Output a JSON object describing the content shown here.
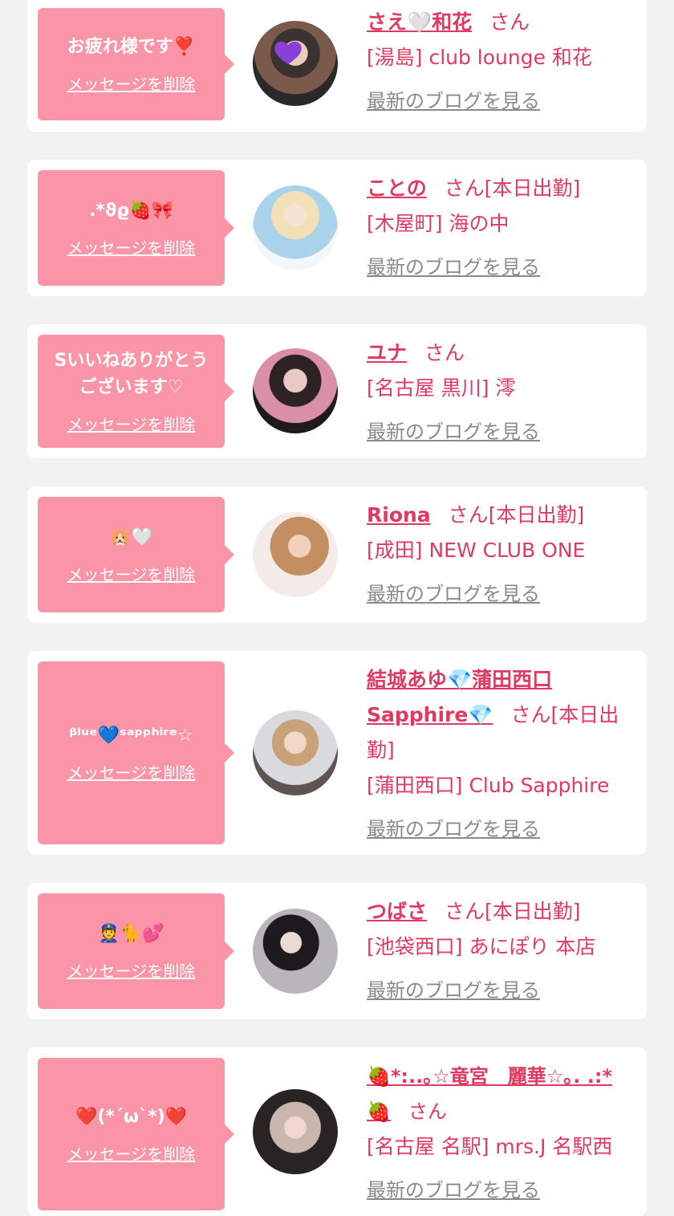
{
  "common": {
    "delete_label": "メッセージを削除",
    "blog_label": "最新のブログを見る",
    "san": "さん"
  },
  "cards": [
    {
      "message": "お疲れ様です❣️",
      "name_a": "さえ",
      "name_icon": "🤍",
      "name_b": "和花",
      "status": "",
      "shop": "[湯島] club lounge 和花"
    },
    {
      "message": ".*ϑϱ🍓🎀",
      "name": "ことの",
      "status": "[本日出勤]",
      "shop": "[木屋町] 海の中"
    },
    {
      "message": "Sいいねありがとうございます♡",
      "name": "ユナ",
      "status": "",
      "shop": "[名古屋 黒川] 澪"
    },
    {
      "message": "🐹🤍",
      "name": "Riona",
      "status": "[本日出勤]",
      "shop": "[成田] NEW CLUB ONE"
    },
    {
      "message": "ᵝˡᵘᵉ💙ˢᵃᵖᵖʰⁱʳᵉ☆",
      "name_a": "結城あゆ",
      "name_icon": "💎",
      "name_b": "蒲田西口",
      "name_c": "Sapphire",
      "name_icon2": "💎",
      "status": "[本日出勤]",
      "shop": "[蒲田西口] Club Sapphire"
    },
    {
      "message": "👮🐈💕",
      "name": "つばさ",
      "status": "[本日出勤]",
      "shop": "[池袋西口] あにぽり 本店"
    },
    {
      "message": "❤️(*´ω`*)❤️",
      "name_a": "🍓*:..｡☆竜宮　麗華☆｡. .:*",
      "name_b": "🍓",
      "status": "",
      "shop": "[名古屋 名駅] mrs.J 名駅西"
    }
  ]
}
